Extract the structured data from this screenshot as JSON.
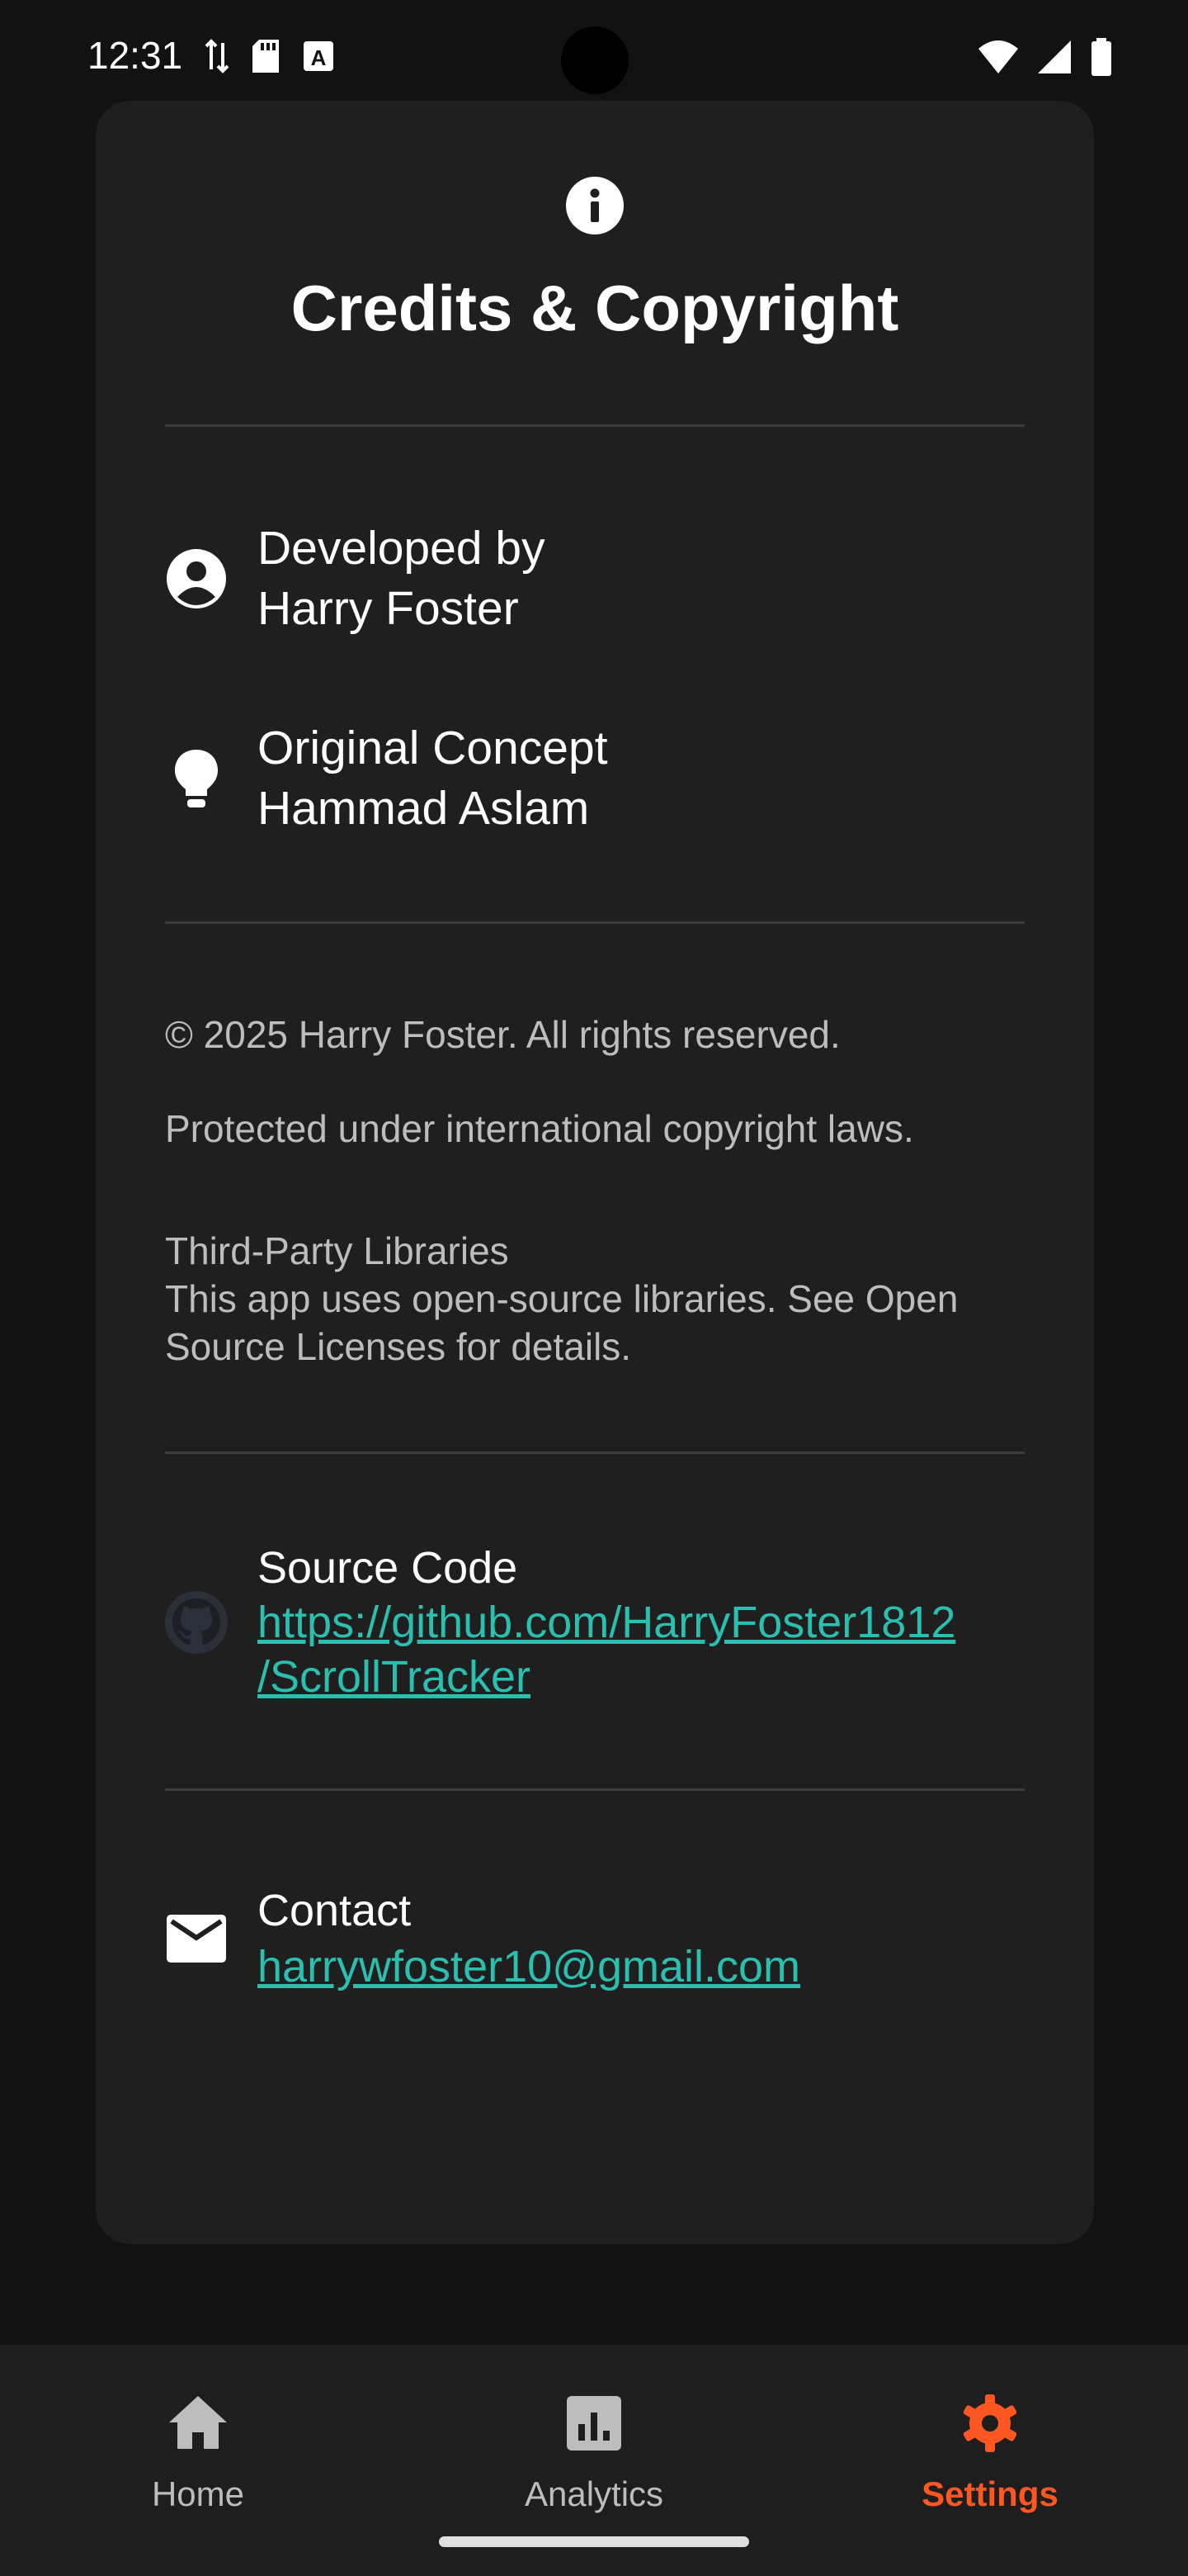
{
  "status_bar": {
    "time": "12:31"
  },
  "card": {
    "title": "Credits & Copyright",
    "credits": [
      {
        "label": "Developed by",
        "value": "Harry Foster",
        "icon": "account-circle-icon"
      },
      {
        "label": "Original Concept",
        "value": "Hammad Aslam",
        "icon": "lightbulb-icon"
      }
    ],
    "copyright": "© 2025 Harry Foster. All rights reserved.",
    "protection": "Protected under international copyright laws.",
    "third_party_title": "Third-Party Libraries",
    "third_party_text": "This app uses open-source libraries. See Open Source Licenses for details.",
    "source": {
      "label": "Source Code",
      "link_line1": "https://github.com/HarryFoster1812",
      "link_line2": "/ScrollTracker",
      "icon": "github-icon"
    },
    "contact": {
      "label": "Contact",
      "email": "harrywfoster10@gmail.com",
      "icon": "mail-icon"
    }
  },
  "bottom_nav": {
    "items": [
      {
        "label": "Home",
        "icon": "home-icon"
      },
      {
        "label": "Analytics",
        "icon": "analytics-icon"
      },
      {
        "label": "Settings",
        "icon": "gear-icon"
      }
    ],
    "active": "Settings",
    "accent": "#FF5722"
  },
  "colors": {
    "background": "#121212",
    "card": "#1F1F1F",
    "link": "#2BBFB0"
  }
}
